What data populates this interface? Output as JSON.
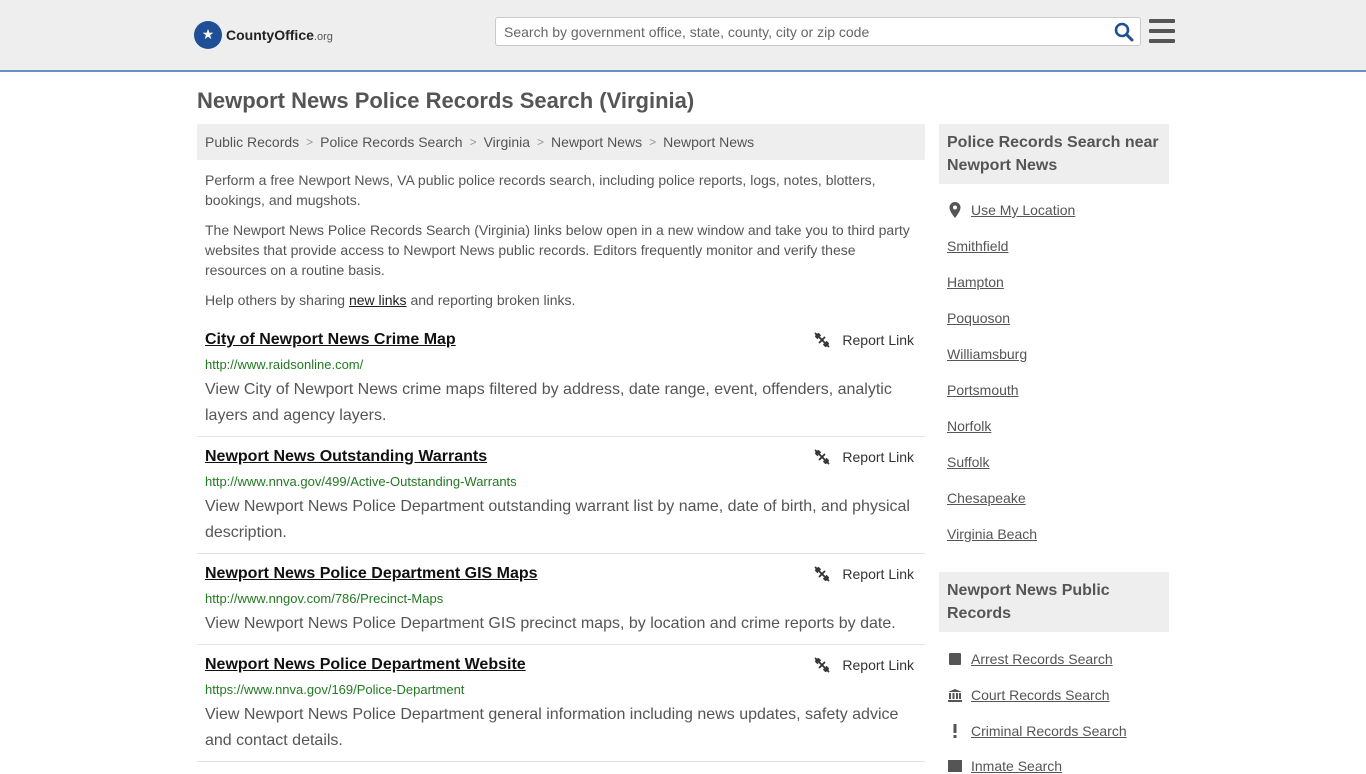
{
  "header": {
    "logo_name": "CountyOffice",
    "logo_tld": ".org",
    "search_placeholder": "Search by government office, state, county, city or zip code",
    "search_icon": "search-icon",
    "menu_icon": "hamburger-menu-icon"
  },
  "page": {
    "title": "Newport News Police Records Search (Virginia)"
  },
  "breadcrumb": [
    "Public Records",
    "Police Records Search",
    "Virginia",
    "Newport News",
    "Newport News"
  ],
  "intro": {
    "p1": "Perform a free Newport News, VA public police records search, including police reports, logs, notes, blotters, bookings, and mugshots.",
    "p2": "The Newport News Police Records Search (Virginia) links below open in a new window and take you to third party websites that provide access to Newport News public records. Editors frequently monitor and verify these resources on a routine basis.",
    "p3_before": "Help others by sharing ",
    "p3_link": "new links",
    "p3_after": " and reporting broken links."
  },
  "report_label": "Report Link",
  "results": [
    {
      "title": "City of Newport News Crime Map",
      "url": "http://www.raidsonline.com/",
      "desc": "View City of Newport News crime maps filtered by address, date range, event, offenders, analytic layers and agency layers."
    },
    {
      "title": "Newport News Outstanding Warrants",
      "url": "http://www.nnva.gov/499/Active-Outstanding-Warrants",
      "desc": "View Newport News Police Department outstanding warrant list by name, date of birth, and physical description."
    },
    {
      "title": "Newport News Police Department GIS Maps",
      "url": "http://www.nngov.com/786/Precinct-Maps",
      "desc": "View Newport News Police Department GIS precinct maps, by location and crime reports by date."
    },
    {
      "title": "Newport News Police Department Website",
      "url": "https://www.nnva.gov/169/Police-Department",
      "desc": "View Newport News Police Department general information including news updates, safety advice and contact details."
    }
  ],
  "sidebar": {
    "nearby_heading": "Police Records Search near Newport News",
    "use_location": "Use My Location",
    "nearby": [
      "Smithfield",
      "Hampton",
      "Poquoson",
      "Williamsburg",
      "Portsmouth",
      "Norfolk",
      "Suffolk",
      "Chesapeake",
      "Virginia Beach"
    ],
    "public_heading": "Newport News Public Records",
    "public_records": [
      {
        "label": "Arrest Records Search",
        "icon": "square-icon"
      },
      {
        "label": "Court Records Search",
        "icon": "courthouse-icon"
      },
      {
        "label": "Criminal Records Search",
        "icon": "exclamation-icon"
      },
      {
        "label": "Inmate Search",
        "icon": "inmate-icon"
      }
    ]
  },
  "colors": {
    "brand_blue": "#1f4f96",
    "url_green": "#217a21",
    "header_bg": "#eeeeee",
    "header_border": "#6a8fc7"
  }
}
